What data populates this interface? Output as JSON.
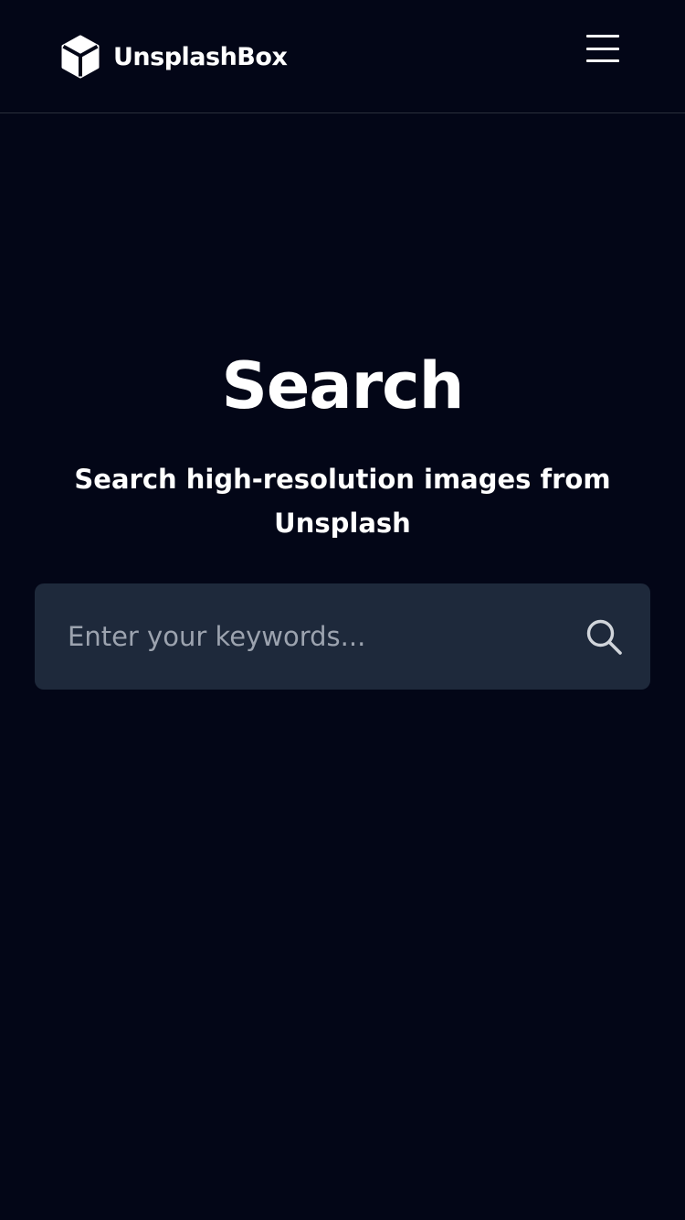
{
  "header": {
    "brand_name": "UnsplashBox",
    "brand_icon": "cube-icon",
    "menu_icon": "hamburger-menu-icon"
  },
  "hero": {
    "title": "Search",
    "subtitle": "Search high-resolution images from Unsplash"
  },
  "search": {
    "placeholder": "Enter your keywords...",
    "value": "",
    "button_icon": "search-icon"
  },
  "colors": {
    "background": "#030617",
    "search_box": "#1e293b",
    "placeholder": "#9ca3af",
    "divider": "#2a2f3b",
    "text": "#ffffff"
  }
}
